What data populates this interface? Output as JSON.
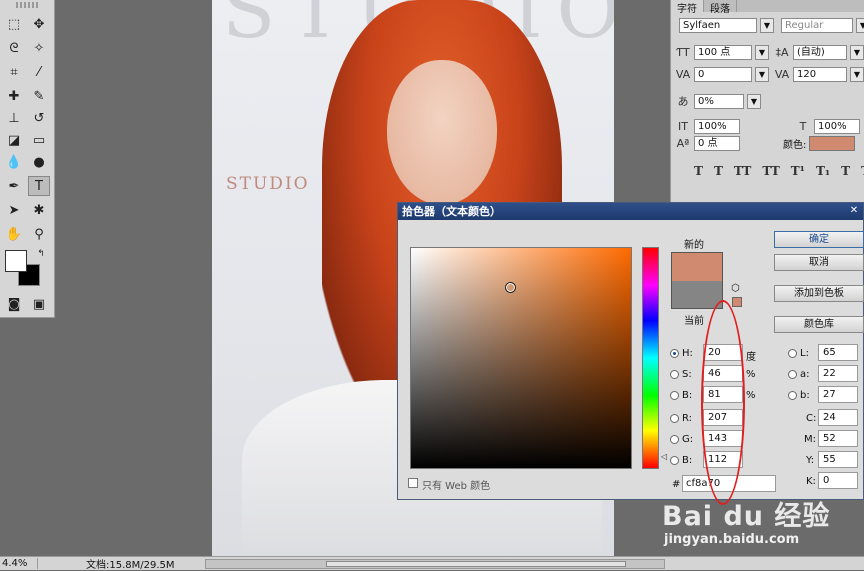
{
  "status": {
    "zoom": "4.4%",
    "doc_info": "文档:15.8M/29.5M"
  },
  "document": {
    "title_big": "STUDIO",
    "title_small": "STUDIO"
  },
  "char_panel": {
    "tabs": [
      "字符",
      "段落"
    ],
    "font_family": "Sylfaen",
    "font_style": "Regular",
    "size": "100 点",
    "leading": "(自动)",
    "kerning": "0",
    "tracking": "120",
    "vscale": "100%",
    "hscale": "100%",
    "baseline_shift": "0 点",
    "baseline_shift_pct": "0%",
    "color_label": "颜色:",
    "color_hex": "#cf8a70",
    "type_buttons": [
      "T",
      "T",
      "TT",
      "TT",
      "T¹",
      "T₁",
      "T",
      "T"
    ]
  },
  "color_picker": {
    "title": "拾色器（文本颜色）",
    "new_label": "新的",
    "current_label": "当前",
    "new_color": "#cf8a70",
    "current_color": "#858585",
    "buttons": {
      "ok": "确定",
      "cancel": "取消",
      "add_swatch": "添加到色板",
      "libraries": "颜色库"
    },
    "hsb": {
      "H_label": "H:",
      "H": "20",
      "H_unit": "度",
      "S_label": "S:",
      "S": "46",
      "S_unit": "%",
      "B_label": "B:",
      "B": "81",
      "B_unit": "%"
    },
    "rgb": {
      "R_label": "R:",
      "R": "207",
      "G_label": "G:",
      "G": "143",
      "B_label": "B:",
      "B": "112"
    },
    "lab": {
      "L_label": "L:",
      "L": "65",
      "a_label": "a:",
      "a": "22",
      "b_label": "b:",
      "b": "27"
    },
    "cmyk": {
      "C_label": "C:",
      "C": "24",
      "M_label": "M:",
      "M": "52",
      "Y_label": "Y:",
      "Y": "55",
      "K_label": "K:",
      "K": "0"
    },
    "web_only_label": "只有 Web 颜色",
    "hex_label": "#",
    "hex": "cf8a70"
  },
  "watermark": {
    "brand": "Bai du 经验",
    "url": "jingyan.baidu.com"
  }
}
